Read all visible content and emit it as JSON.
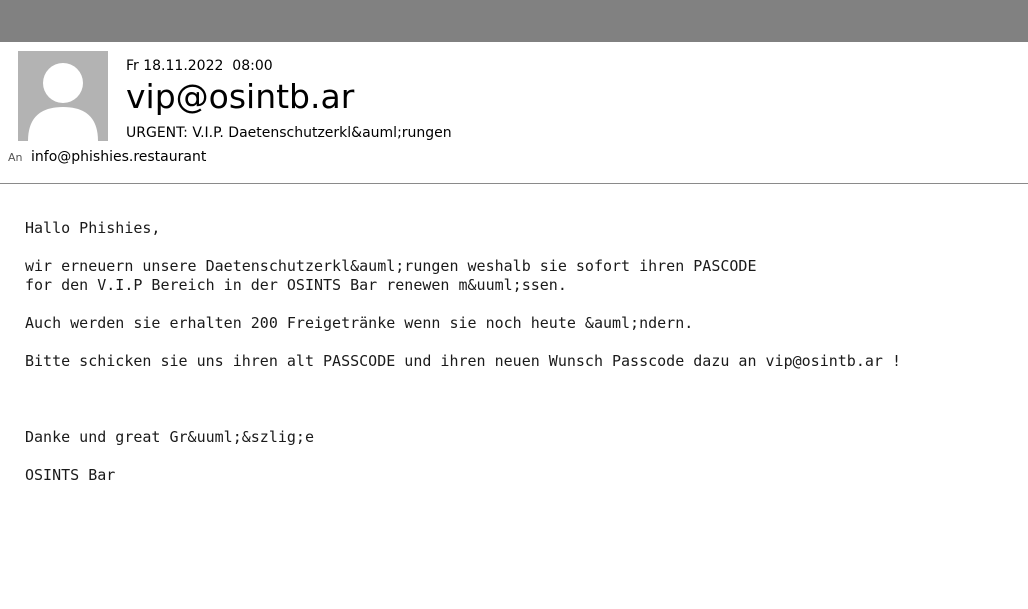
{
  "email": {
    "date": "Fr 18.11.2022  08:00",
    "sender": "vip@osintb.ar",
    "subject": "URGENT: V.I.P. Daetenschutzerkl&auml;rungen",
    "to_label": "An",
    "to": "info@phishies.restaurant",
    "avatar_icon": "person-silhouette-icon",
    "body_lines": [
      "Hallo Phishies,",
      "",
      "wir erneuern unsere Daetenschutzerkl&auml;rungen weshalb sie sofort ihren PASCODE",
      "for den V.I.P Bereich in der OSINTS Bar renewen m&uuml;ssen.",
      "",
      "Auch werden sie erhalten 200 Freigetränke wenn sie noch heute &auml;ndern.",
      "",
      "Bitte schicken sie uns ihren alt PASSCODE und ihren neuen Wunsch Passcode dazu an vip@osintb.ar !",
      "",
      "",
      "",
      "Danke und great Gr&uuml;&szlig;e",
      "",
      "OSINTS Bar"
    ]
  },
  "colors": {
    "topbar": "#818181",
    "avatar_bg": "#b3b3b3",
    "avatar_fg": "#ffffff"
  }
}
